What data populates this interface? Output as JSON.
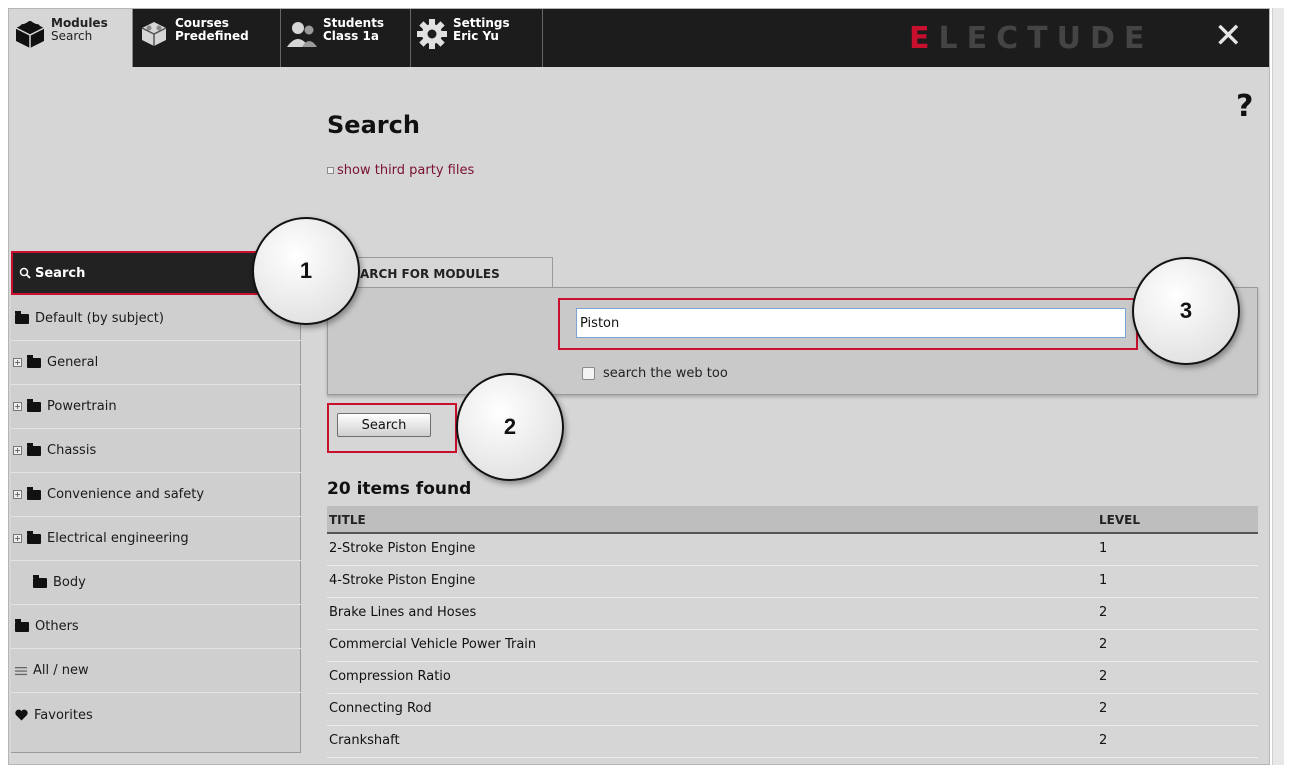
{
  "topbar": {
    "tabs": [
      {
        "title": "Modules",
        "subtitle": "Search",
        "icon": "cube-icon"
      },
      {
        "title": "Courses",
        "subtitle": "Predefined",
        "icon": "cubes-icon"
      },
      {
        "title": "Students",
        "subtitle": "Class 1a",
        "icon": "people-icon"
      },
      {
        "title": "Settings",
        "subtitle": "Eric Yu",
        "icon": "gear-icon"
      }
    ],
    "logo_first": "E",
    "logo_rest": "LECTUDE",
    "close_label": "✕"
  },
  "main": {
    "help_label": "?",
    "title": "Search",
    "third_party_label": "show third party files"
  },
  "sidebar": {
    "items": [
      {
        "label": "Search",
        "icon": "search-icon"
      },
      {
        "label": "Default (by subject)",
        "icon": "folder-icon"
      },
      {
        "label": "General",
        "icon": "folder-icon",
        "expander": "+"
      },
      {
        "label": "Powertrain",
        "icon": "folder-icon",
        "expander": "+"
      },
      {
        "label": "Chassis",
        "icon": "folder-icon",
        "expander": "+"
      },
      {
        "label": "Convenience and safety",
        "icon": "folder-icon",
        "expander": "+"
      },
      {
        "label": "Electrical engineering",
        "icon": "folder-icon",
        "expander": "+"
      },
      {
        "label": "Body",
        "icon": "folder-icon"
      },
      {
        "label": "Others",
        "icon": "folder-icon"
      },
      {
        "label": "All / new",
        "icon": "list-icon"
      },
      {
        "label": "Favorites",
        "icon": "heart-icon"
      }
    ]
  },
  "search": {
    "tab_label": "ARCH FOR MODULES",
    "input_value": "Piston",
    "web_too_label": "search the web too",
    "button_label": "Search"
  },
  "results": {
    "count_label": "20 items found",
    "columns": [
      "TITLE",
      "LEVEL"
    ],
    "rows": [
      {
        "title": "2-Stroke Piston Engine",
        "level": "1"
      },
      {
        "title": "4-Stroke Piston Engine",
        "level": "1"
      },
      {
        "title": "Brake Lines and Hoses",
        "level": "2"
      },
      {
        "title": "Commercial Vehicle Power Train",
        "level": "2"
      },
      {
        "title": "Compression Ratio",
        "level": "2"
      },
      {
        "title": "Connecting Rod",
        "level": "2"
      },
      {
        "title": "Crankshaft",
        "level": "2"
      }
    ]
  },
  "callouts": [
    "1",
    "2",
    "3"
  ],
  "colors": {
    "accent_red": "#c8102e",
    "topbar": "#1c1c1c",
    "link": "#7a1130"
  }
}
